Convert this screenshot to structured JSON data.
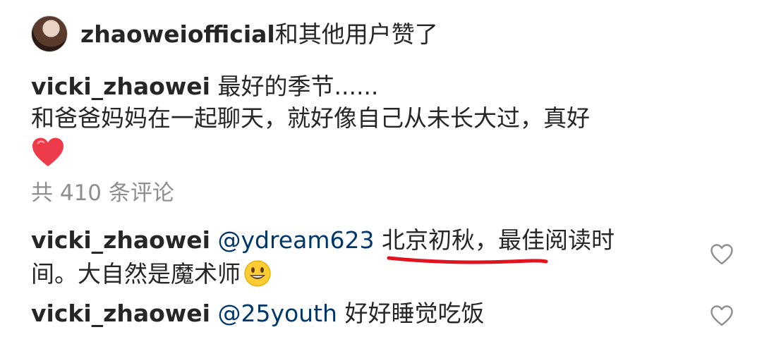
{
  "likes": {
    "username": "zhaoweiofficial",
    "suffix": "和其他用户赞了"
  },
  "post": {
    "author": "vicki_zhaowei",
    "line1": "最好的季节......",
    "line2": "和爸爸妈妈在一起聊天，就好像自己从未长大过，真好",
    "emoji": "heart-emoji"
  },
  "comments_count": "共 410 条评论",
  "comments": [
    {
      "author": "vicki_zhaowei",
      "mention": "@ydream623",
      "highlight": "北京初秋，",
      "text_rest": "最佳阅读时",
      "text_line2": "间。大自然是魔术师",
      "emoji": "smiley-emoji",
      "like_icon": "heart-outline-icon"
    },
    {
      "author": "vicki_zhaowei",
      "mention": "@25youth",
      "text": "好好睡觉吃饭",
      "like_icon": "heart-outline-icon"
    }
  ],
  "colors": {
    "text": "#262626",
    "mention": "#00376b",
    "muted": "#8e8e8e",
    "heart_red": "#ed4956",
    "underline_red": "#e0141e"
  }
}
